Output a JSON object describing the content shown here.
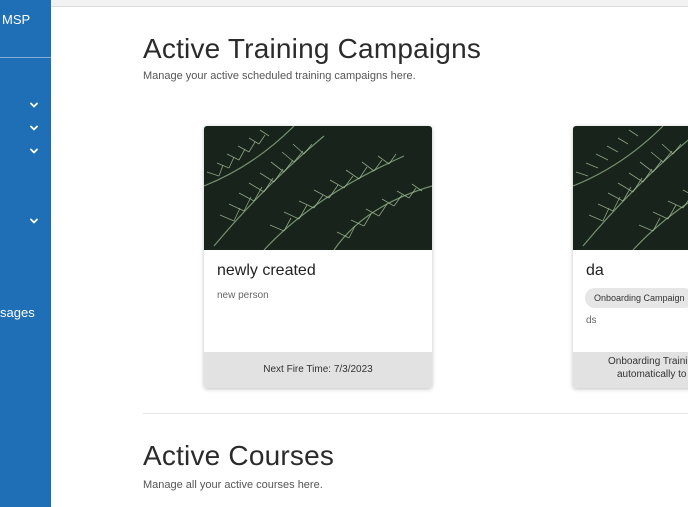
{
  "sidebar": {
    "brand": "MSP",
    "messages_label": "sages"
  },
  "campaigns": {
    "title": "Active Training Campaigns",
    "subtitle": "Manage your active scheduled training campaigns here.",
    "cards": [
      {
        "title": "newly created",
        "description": "new person",
        "footer": "Next Fire Time: 7/3/2023"
      },
      {
        "title": "da",
        "badge": "Onboarding Campaign",
        "description": "ds",
        "footer_line1": "Onboarding Training",
        "footer_line2": "automatically to n"
      }
    ]
  },
  "courses": {
    "title": "Active Courses",
    "subtitle": "Manage all your active courses here."
  },
  "colors": {
    "sidebar": "#1f6fb7",
    "footer_bg": "#e2e2e2",
    "badge_bg": "#e6e6e6"
  }
}
